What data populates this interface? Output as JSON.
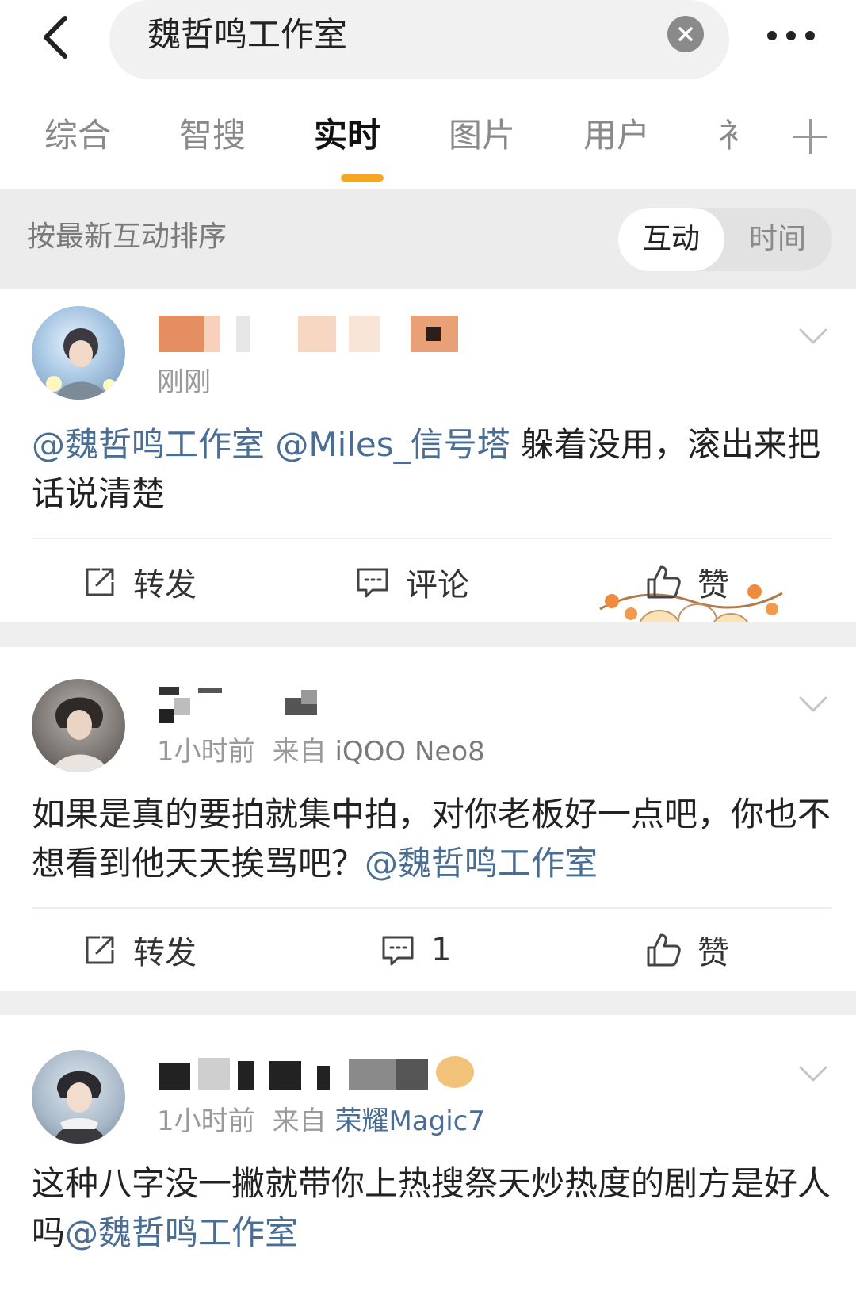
{
  "search": {
    "query": "魏哲鸣工作室"
  },
  "tabs": [
    {
      "label": "综合"
    },
    {
      "label": "智搜"
    },
    {
      "label": "实时"
    },
    {
      "label": "图片"
    },
    {
      "label": "用户"
    },
    {
      "label": "衤"
    }
  ],
  "sort": {
    "label": "按最新互动排序",
    "option_active": "互动",
    "option_inactive": "时间"
  },
  "posts": [
    {
      "time": "刚刚",
      "source_prefix": "",
      "source": "",
      "text_parts": [
        {
          "text": "@魏哲鸣工作室 @Miles_信号塔",
          "mention": true
        },
        {
          "text": " 躲着没用，滚出来把话说清楚",
          "mention": false
        }
      ],
      "actions": {
        "repost": "转发",
        "comment": "评论",
        "like": "赞"
      }
    },
    {
      "time": "1小时前",
      "source_prefix": "来自",
      "source": "iQOO Neo8",
      "text_parts": [
        {
          "text": "如果是真的要拍就集中拍，对你老板好一点吧，你也不想看到他天天挨骂吧？",
          "mention": false
        },
        {
          "text": "@魏哲鸣工作室",
          "mention": true
        }
      ],
      "actions": {
        "repost": "转发",
        "comment": "1",
        "like": "赞"
      }
    },
    {
      "time": "1小时前",
      "source_prefix": "来自",
      "source": "荣耀Magic7",
      "text_parts": [
        {
          "text": "这种八字没一撇就带你上热搜祭天炒热度的剧方是好人吗",
          "mention": false
        },
        {
          "text": "@魏哲鸣工作室",
          "mention": true
        }
      ]
    }
  ],
  "colors": {
    "accent": "#f5a623",
    "link": "#4a6d94",
    "muted": "#9a9a9a",
    "page_bg": "#efefef"
  },
  "icons": [
    "back-arrow-icon",
    "clear-icon",
    "more-icon",
    "plus-icon",
    "chevron-down-icon",
    "repost-icon",
    "comment-icon",
    "like-icon"
  ]
}
